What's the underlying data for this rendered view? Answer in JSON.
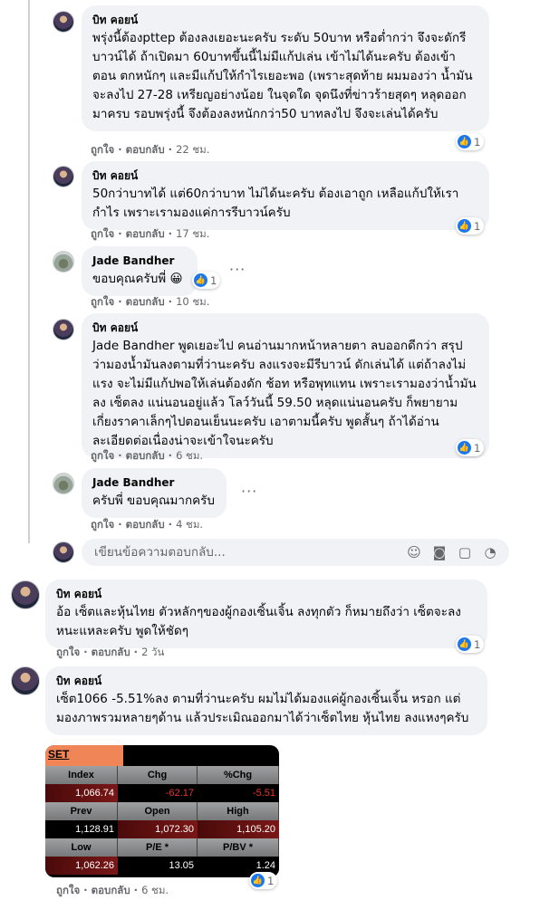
{
  "comments": [
    {
      "author": "บิท คอยน์",
      "text": "พรุ่งนี้ต้องpttep ต้องลงเยอะนะครับ ระดับ 50บาท หรือต่ำกว่า จึงจะดักรีบาวน์ได้ ถ้าเปิดมา 60บาทขึ้นนี้ไม่มีแก้ปเล่น เข้าไม่ได้นะครับ ต้องเข้าตอน ตกหนักๆ และมีแก้ปให้กำไรเยอะพอ (เพราะสุดท้าย ผมมองว่า น้ำมันจะลงไป 27-28 เหรียญอย่างน้อย ในจุดใด จุดนึงที่ข่าวร้ายสุดๆ หลุดออกมาครบ รอบพรุ่งนี้ จึงต้องลงหนักกว่า50 บาทลงไป จึงจะเล่นได้ครับ",
      "like": "ถูกใจ",
      "reply": "ตอบกลับ",
      "time": "22 ชม.",
      "reactions": "1"
    },
    {
      "author": "บิท คอยน์",
      "text": "50กว่าบาทได้ แต่60กว่าบาท ไม่ได้นะครับ ต้องเอาถูก เหลือแก้ปให้เรากำไร เพราะเรามองแค่การรีบาวน์ครับ",
      "like": "ถูกใจ",
      "reply": "ตอบกลับ",
      "time": "17 ชม.",
      "reactions": "1"
    },
    {
      "author": "Jade Bandher",
      "text": "ขอบคุณครับพี่ 😀",
      "like": "ถูกใจ",
      "reply": "ตอบกลับ",
      "time": "10 ชม.",
      "reactions": "1"
    },
    {
      "author": "บิท คอยน์",
      "text": "Jade Bandher พูดเยอะไป คนอ่านมากหน้าหลายตา ลบออกดีกว่า สรุป ว่ามองน้ำมันลงตามที่ว่านะครับ ลงแรงจะมีรีบาวน์ ดักเล่นได้ แต่ถ้าลงไม่แรง จะไม่มีแก้ปพอให้เล่นต้องดัก ช้อท หรือพุทแทน เพราะเรามองว่าน้ำมันลง เซ็ตลง แน่นอนอยู่แล้ว โลว์วันนี้ 59.50 หลุดแน่นอนครับ ก็พยายามเกี่ยงราคาเล็กๆไปตอนเย็นนะครับ เอาตามนี้ครับ พูดสั้นๆ ถ้าได้อ่านละเอียดต่อเนื่องน่าจะเข้าใจนะครับ",
      "like": "ถูกใจ",
      "reply": "ตอบกลับ",
      "time": "6 ชม.",
      "reactions": "1"
    },
    {
      "author": "Jade Bandher",
      "text": "ครับพี่ ขอบคุณมากครับ",
      "like": "ถูกใจ",
      "reply": "ตอบกลับ",
      "time": "4 ชม."
    }
  ],
  "reply_box": {
    "placeholder": "เขียนข้อความตอบกลับ..."
  },
  "top_comments": [
    {
      "author": "บิท คอยน์",
      "text": "อ้อ เซ็ตและหุ้นไทย ตัวหลักๆของผู้กองเซิ้นเจิ้น ลงทุกตัว ก็หมายถึงว่า เซ็ตจะลงหนะแหละครับ พูดให้ชัดๆ",
      "like": "ถูกใจ",
      "reply": "ตอบกลับ",
      "time": "2 วัน",
      "reactions": "1"
    },
    {
      "author": "บิท คอยน์",
      "text": "เซ็ต1066 -5.51%ลง ตามที่ว่านะครับ ผมไม่ได้มองแค่ผู้กองเซิ้นเจิ้น หรอก แต่มองภาพรวมหลายๆด้าน แล้วประเมิณออกมาได้ว่าเซ็ตไทย หุ้นไทย ลงแหงๆครับ",
      "like": "ถูกใจ",
      "reply": "ตอบกลับ",
      "time": "6 ชม.",
      "reactions": "1"
    }
  ],
  "set_table": {
    "title": "SET",
    "rows": [
      {
        "labels": [
          "Index",
          "Chg",
          "%Chg"
        ],
        "values": [
          "1,066.74",
          "-62.17",
          "-5.51"
        ]
      },
      {
        "labels": [
          "Prev",
          "Open",
          "High"
        ],
        "values": [
          "1,128.91",
          "1,072.30",
          "1,105.20"
        ]
      },
      {
        "labels": [
          "Low",
          "P/E *",
          "P/BV *"
        ],
        "values": [
          "1,062.26",
          "13.05",
          "1.24"
        ]
      }
    ]
  }
}
